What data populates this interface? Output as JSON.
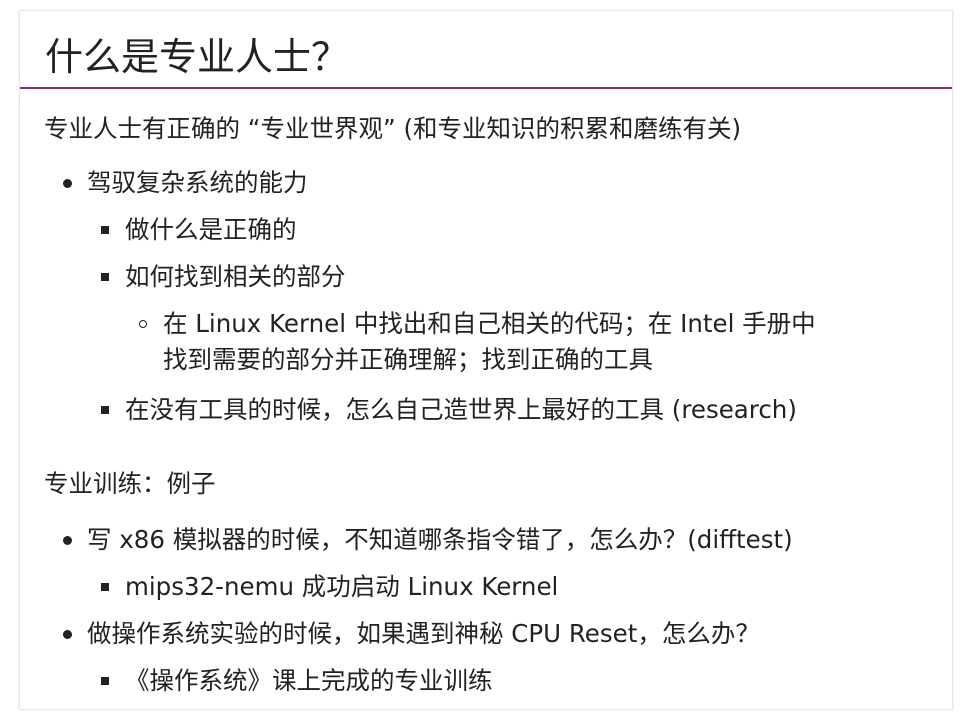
{
  "slide": {
    "title": "什么是专业人士？",
    "accent_color": "#8b2c7b"
  },
  "content": {
    "intro": "专业人士有正确的 “专业世界观” (和专业知识的积累和磨练有关)",
    "item_1": "驾驭复杂系统的能力",
    "item_1_1": "做什么是正确的",
    "item_1_2": "如何找到相关的部分",
    "item_1_2_1_line1": "在 Linux Kernel 中找出和自己相关的代码；在 Intel 手册中",
    "item_1_2_1_line2": "找到需要的部分并正确理解；找到正确的工具",
    "item_1_3": "在没有工具的时候，怎么自己造世界上最好的工具 (research)",
    "section_2": "专业训练：例子",
    "item_2": "写 x86 模拟器的时候，不知道哪条指令错了，怎么办？(difftest)",
    "item_2_1": "mips32-nemu 成功启动 Linux Kernel",
    "item_3": "做操作系统实验的时候，如果遇到神秘 CPU Reset，怎么办？",
    "item_3_1": "《操作系统》课上完成的专业训练"
  }
}
